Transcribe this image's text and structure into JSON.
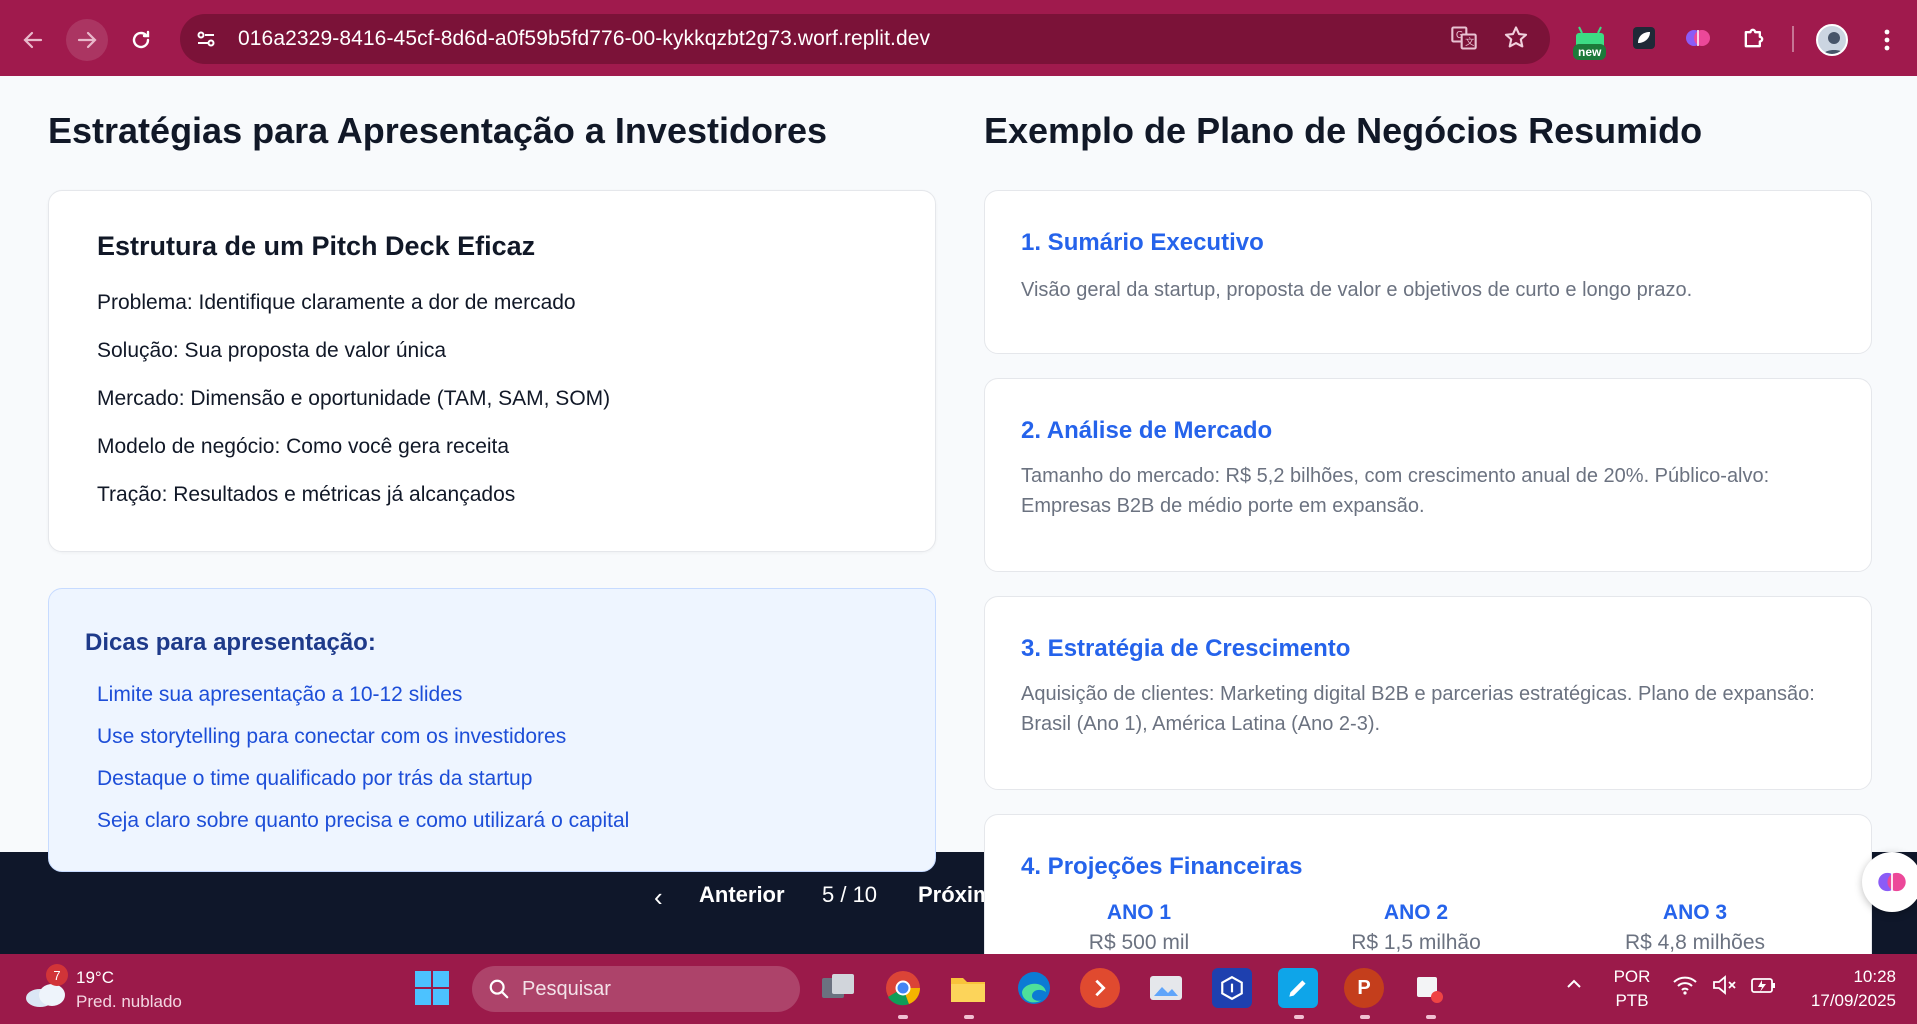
{
  "browser": {
    "url": "016a2329-8416-45cf-8d6d-a0f59b5fd776-00-kykkqzbt2g73.worf.replit.dev",
    "new_badge": "new"
  },
  "left": {
    "heading": "Estratégias para Apresentação a Investidores",
    "card_title": "Estrutura de um Pitch Deck Eficaz",
    "items": [
      "Problema: Identifique claramente a dor de mercado",
      "Solução: Sua proposta de valor única",
      "Mercado: Dimensão e oportunidade (TAM, SAM, SOM)",
      "Modelo de negócio: Como você gera receita",
      "Tração: Resultados e métricas já alcançados"
    ],
    "tips_title": "Dicas para apresentação:",
    "tips": [
      "Limite sua apresentação a 10-12 slides",
      "Use storytelling para conectar com os investidores",
      "Destaque o time qualificado por trás da startup",
      "Seja claro sobre quanto precisa e como utilizará o capital"
    ]
  },
  "right": {
    "heading": "Exemplo de Plano de Negócios Resumido",
    "sections": [
      {
        "title": "1. Sumário Executivo",
        "desc": "Visão geral da startup, proposta de valor e objetivos de curto e longo prazo."
      },
      {
        "title": "2. Análise de Mercado",
        "desc": "Tamanho do mercado: R$ 5,2 bilhões, com crescimento anual de 20%. Público-alvo: Empresas B2B de médio porte em expansão."
      },
      {
        "title": "3. Estratégia de Crescimento",
        "desc": "Aquisição de clientes: Marketing digital B2B e parcerias estratégicas. Plano de expansão: Brasil (Ano 1), América Latina (Ano 2-3)."
      },
      {
        "title": "4. Projeções Financeiras",
        "desc": ""
      }
    ],
    "projections": [
      {
        "year": "ANO 1",
        "value": "R$ 500 mil"
      },
      {
        "year": "ANO 2",
        "value": "R$ 1,5 milhão"
      },
      {
        "year": "ANO 3",
        "value": "R$ 4,8 milhões"
      }
    ]
  },
  "slide_nav": {
    "prev": "Anterior",
    "counter": "5 / 10",
    "next": "Próxim"
  },
  "taskbar": {
    "weather_temp": "19°C",
    "weather_cond": "Pred. nublado",
    "notif_count": "7",
    "search_placeholder": "Pesquisar",
    "lang_top": "POR",
    "lang_bottom": "PTB",
    "time": "10:28",
    "date": "17/09/2025"
  }
}
